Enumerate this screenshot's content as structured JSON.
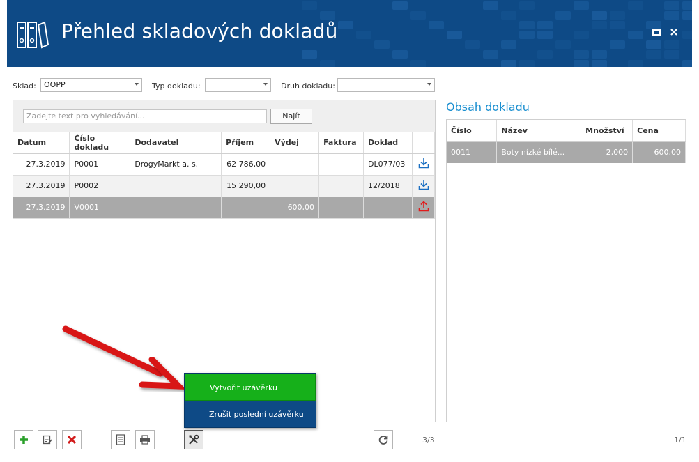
{
  "header": {
    "title": "Přehled skladových dokladů",
    "maximize_icon": "maximize-icon",
    "close_icon": "close-icon",
    "bg_color": "#0e4a86"
  },
  "filters": {
    "sklad_label": "Sklad:",
    "sklad_value": "OOPP",
    "typ_label": "Typ dokladu:",
    "typ_value": "",
    "druh_label": "Druh dokladu:",
    "druh_value": ""
  },
  "search": {
    "placeholder": "Zadejte text pro vyhledávání...",
    "button": "Najít"
  },
  "documents": {
    "columns": [
      "Datum",
      "Číslo dokladu",
      "Dodavatel",
      "Příjem",
      "Výdej",
      "Faktura",
      "Doklad"
    ],
    "rows": [
      {
        "datum": "27.3.2019",
        "cislo": "P0001",
        "dodavatel": "DrogyMarkt a. s.",
        "prijem": "62 786,00",
        "vydej": "",
        "faktura": "",
        "doklad": "DL077/03",
        "icon": "download-icon"
      },
      {
        "datum": "27.3.2019",
        "cislo": "P0002",
        "dodavatel": "",
        "prijem": "15 290,00",
        "vydej": "",
        "faktura": "",
        "doklad": "12/2018",
        "icon": "download-icon"
      },
      {
        "datum": "27.3.2019",
        "cislo": "V0001",
        "dodavatel": "",
        "prijem": "",
        "vydej": "600,00",
        "faktura": "",
        "doklad": "",
        "icon": "upload-icon"
      }
    ],
    "counter": "3/3"
  },
  "content": {
    "title": "Obsah dokladu",
    "columns": [
      "Číslo",
      "Název",
      "Množství",
      "Cena"
    ],
    "rows": [
      {
        "cislo": "0011",
        "nazev": "Boty nízké bílé...",
        "mnozstvi": "2,000",
        "cena": "600,00"
      }
    ],
    "counter": "1/1"
  },
  "toolbar": {
    "add_icon": "plus-icon",
    "edit_icon": "edit-icon",
    "delete_icon": "delete-icon",
    "document_icon": "document-icon",
    "print_icon": "print-icon",
    "tools_icon": "tools-icon",
    "refresh_icon": "refresh-icon"
  },
  "popup_menu": {
    "items": [
      "Vytvořit uzávěrku",
      "Zrušit poslední uzávěrku"
    ],
    "highlight_color": "#16b01a"
  },
  "colors": {
    "accent_blue": "#1a8fd0",
    "selected_row": "#a9a9a9",
    "arrow_red": "#d81818"
  }
}
